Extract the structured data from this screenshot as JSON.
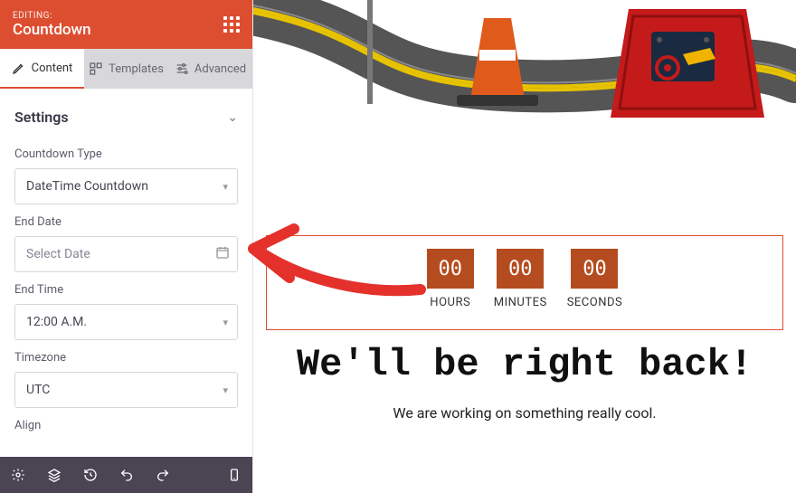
{
  "header": {
    "editing_label": "EDITING:",
    "title": "Countdown"
  },
  "tabs": {
    "content": "Content",
    "templates": "Templates",
    "advanced": "Advanced"
  },
  "settings": {
    "title": "Settings",
    "countdown_type": {
      "label": "Countdown Type",
      "value": "DateTime Countdown"
    },
    "end_date": {
      "label": "End Date",
      "placeholder": "Select Date"
    },
    "end_time": {
      "label": "End Time",
      "value": "12:00 A.M."
    },
    "timezone": {
      "label": "Timezone",
      "value": "UTC"
    },
    "align": {
      "label": "Align"
    }
  },
  "preview": {
    "countdown": [
      {
        "value": "00",
        "label": "HOURS"
      },
      {
        "value": "00",
        "label": "MINUTES"
      },
      {
        "value": "00",
        "label": "SECONDS"
      }
    ],
    "heading": "We'll be right back!",
    "subtitle": "We are working on something really cool."
  },
  "icons": {
    "content": "pencil-icon",
    "templates": "templates-icon",
    "advanced": "sliders-icon",
    "gear": "gear-icon",
    "layers": "layers-icon",
    "history": "history-icon",
    "undo": "undo-icon",
    "redo": "redo-icon",
    "mobile": "mobile-icon"
  }
}
